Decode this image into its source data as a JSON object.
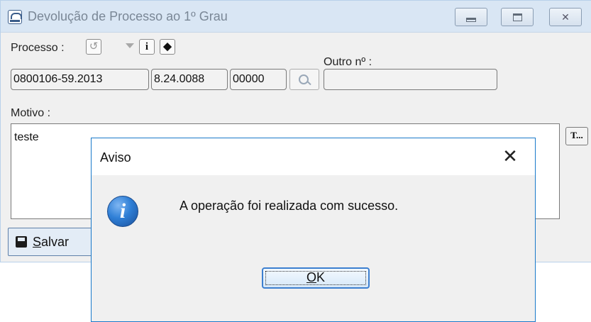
{
  "window": {
    "title": "Devolução de Processo ao 1º Grau",
    "app_icon": "saj-icon"
  },
  "form": {
    "processo_label": "Processo :",
    "outro_label": "Outro nº :",
    "processo_numero": "0800106-59.2013",
    "processo_codigo": "8.24.0088",
    "processo_foro": "00000",
    "outro_numero": "",
    "motivo_label": "Motivo :",
    "motivo_value": "teste",
    "template_button": "T..."
  },
  "toolbar": {
    "save_label": "Salvar",
    "save_accel": "S",
    "save_rest": "alvar"
  },
  "dialog": {
    "title": "Aviso",
    "close_glyph": "✕",
    "message": "A operação foi realizada com sucesso.",
    "ok_label": "OK",
    "ok_accel": "O",
    "ok_rest": "K",
    "icon": "information-icon"
  },
  "colors": {
    "dialog_border": "#1979ca",
    "ok_border": "#3c7fd0",
    "titlebar": "#d9e6f4"
  }
}
